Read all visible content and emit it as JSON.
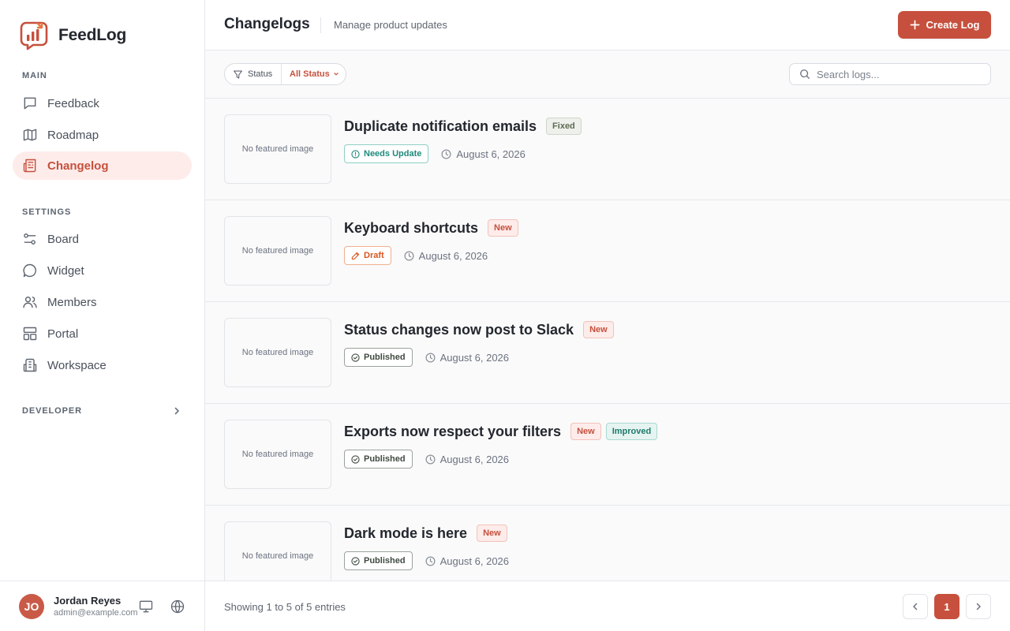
{
  "app": {
    "name": "FeedLog"
  },
  "colors": {
    "accent": "#c6503d",
    "accent_soft": "#fdecea",
    "teal": "#1d8a7b",
    "draft": "#d9561f"
  },
  "sidebar": {
    "sections": [
      {
        "title": "MAIN",
        "items": [
          {
            "label": "Feedback",
            "icon": "message-square-icon",
            "active": false
          },
          {
            "label": "Roadmap",
            "icon": "map-icon",
            "active": false
          },
          {
            "label": "Changelog",
            "icon": "newspaper-icon",
            "active": true
          }
        ]
      },
      {
        "title": "SETTINGS",
        "items": [
          {
            "label": "Board",
            "icon": "sliders-icon",
            "active": false
          },
          {
            "label": "Widget",
            "icon": "chat-bubble-icon",
            "active": false
          },
          {
            "label": "Members",
            "icon": "users-icon",
            "active": false
          },
          {
            "label": "Portal",
            "icon": "layout-icon",
            "active": false
          },
          {
            "label": "Workspace",
            "icon": "building-icon",
            "active": false
          }
        ]
      },
      {
        "title": "DEVELOPER",
        "collapsed": true
      }
    ]
  },
  "user": {
    "initials": "JO",
    "name": "Jordan Reyes",
    "email": "admin@example.com"
  },
  "header": {
    "title": "Changelogs",
    "subtitle": "Manage product updates",
    "create_label": "Create Log"
  },
  "toolbar": {
    "filter_label": "Status",
    "filter_value": "All Status",
    "search_placeholder": "Search logs..."
  },
  "logs": [
    {
      "title": "Duplicate notification emails",
      "tags": [
        {
          "label": "Fixed",
          "kind": "fixed"
        }
      ],
      "status": "Needs Update",
      "status_kind": "needs",
      "date": "August 6, 2026",
      "thumb": "No featured image"
    },
    {
      "title": "Keyboard shortcuts",
      "tags": [
        {
          "label": "New",
          "kind": "new"
        }
      ],
      "status": "Draft",
      "status_kind": "draft",
      "date": "August 6, 2026",
      "thumb": "No featured image"
    },
    {
      "title": "Status changes now post to Slack",
      "tags": [
        {
          "label": "New",
          "kind": "new"
        }
      ],
      "status": "Published",
      "status_kind": "published",
      "date": "August 6, 2026",
      "thumb": "No featured image"
    },
    {
      "title": "Exports now respect your filters",
      "tags": [
        {
          "label": "New",
          "kind": "new"
        },
        {
          "label": "Improved",
          "kind": "improved"
        }
      ],
      "status": "Published",
      "status_kind": "published",
      "date": "August 6, 2026",
      "thumb": "No featured image"
    },
    {
      "title": "Dark mode is here",
      "tags": [
        {
          "label": "New",
          "kind": "new"
        }
      ],
      "status": "Published",
      "status_kind": "published",
      "date": "August 6, 2026",
      "thumb": "No featured image"
    }
  ],
  "footer": {
    "info": "Showing 1 to 5 of 5 entries",
    "current_page": "1"
  }
}
